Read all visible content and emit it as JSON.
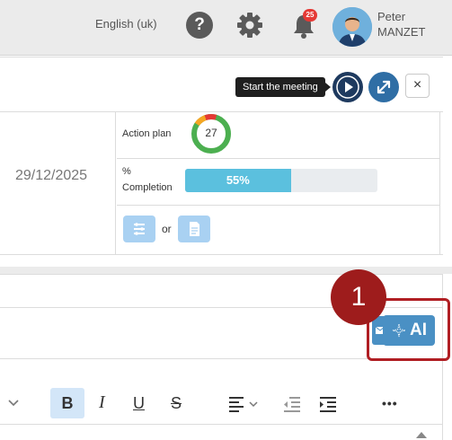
{
  "topbar": {
    "language": "English (uk)",
    "notifications_count": "25",
    "user_first_name": "Peter",
    "user_last_name": "MANZET"
  },
  "meeting": {
    "tooltip": "Start the meeting",
    "close_label": "×",
    "date": "29/12/2025",
    "action_plan_label": "Action plan",
    "action_plan_count": "27",
    "completion_label_1": "%",
    "completion_label_2": "Completion",
    "completion_value": "55%",
    "or_label": "or"
  },
  "ai": {
    "label": "AI",
    "step_number": "1"
  },
  "toolbar": {
    "bold": "B",
    "italic": "I",
    "underline": "U",
    "strike": "S",
    "more": "•••"
  },
  "colors": {
    "accent": "#4a90c4",
    "progress": "#5bc0de",
    "highlight": "#b01e23",
    "notification": "#e53935"
  }
}
